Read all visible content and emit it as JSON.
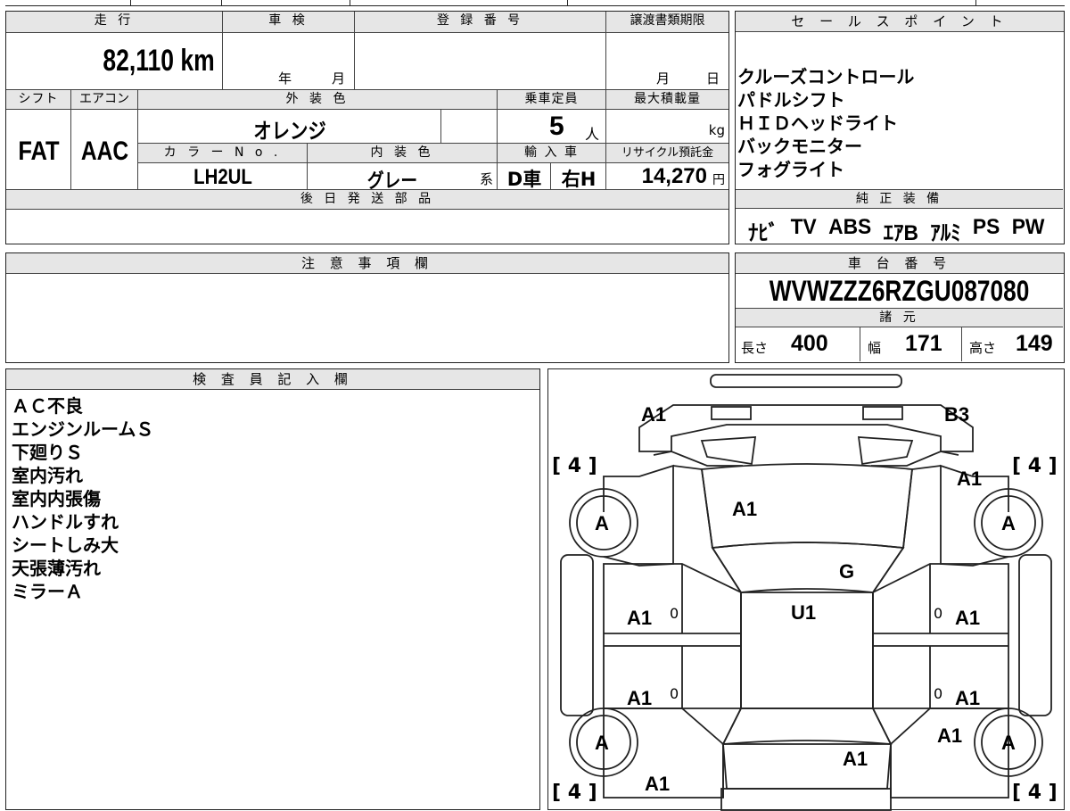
{
  "labels": {
    "mileage": "走 行",
    "shaken": "車 検",
    "registration": "登 録 番 号",
    "transfer_deadline": "譲渡書類期限",
    "sales_points": "セ ー ル ス ポ イ ン ト",
    "shift": "シフト",
    "aircon": "エアコン",
    "exterior_color": "外 装 色",
    "capacity": "乗車定員",
    "max_load": "最大積載量",
    "color_no": "カ ラ ー N o .",
    "interior_color": "内 装 色",
    "import": "輸 入 車",
    "recycle": "リサイクル預託金",
    "later_parts": "後 日 発 送 部 品",
    "genuine_equipment": "純 正 装 備",
    "notes": "注 意 事 項 欄",
    "chassis_no": "車 台 番 号",
    "specs": "諸 元",
    "inspector": "検 査 員 記 入 欄",
    "year": "年",
    "month": "月",
    "day": "日",
    "person": "人",
    "kg": "kg",
    "yen": "円",
    "kei": "系",
    "length": "長さ",
    "width": "幅",
    "height": "高さ"
  },
  "vehicle": {
    "mileage": "82,110 km",
    "shift": "FAT",
    "aircon": "AAC",
    "exterior_color": "オレンジ",
    "capacity": "5",
    "color_no": "LH2UL",
    "interior_color": "グレー",
    "import_car": "D車",
    "steering": "右H",
    "recycle_fee": "14,270",
    "chassis_no": "WVWZZZ6RZGU087080",
    "length": "400",
    "width": "171",
    "height": "149"
  },
  "sales_points": [
    "クルーズコントロール",
    "パドルシフト",
    "ＨＩＤヘッドライト",
    "バックモニター",
    "フォグライト"
  ],
  "equipment": [
    "ﾅﾋﾞ",
    "TV",
    "ABS",
    "ｴｱB",
    "ｱﾙﾐ",
    "PS",
    "PW"
  ],
  "inspector_notes": [
    "ＡＣ不良",
    "エンジンルームＳ",
    "下廻りＳ",
    "室内汚れ",
    "室内内張傷",
    "ハンドルすれ",
    "シートしみ大",
    "天張薄汚れ",
    "ミラーＡ"
  ],
  "diagram": {
    "front_left": "A1",
    "front_right": "B3",
    "tire_bracket": "[ 4 ]",
    "hood": "A1",
    "fender_right": "A1",
    "wheel": "A",
    "windshield": "G",
    "roof": "U1",
    "door_fl": "A1",
    "door_fr": "A1",
    "door_rl": "A1",
    "door_rr": "A1",
    "quarter_rr": "A1",
    "trunk": "A1",
    "rear_left": "A1",
    "zero": "0"
  }
}
